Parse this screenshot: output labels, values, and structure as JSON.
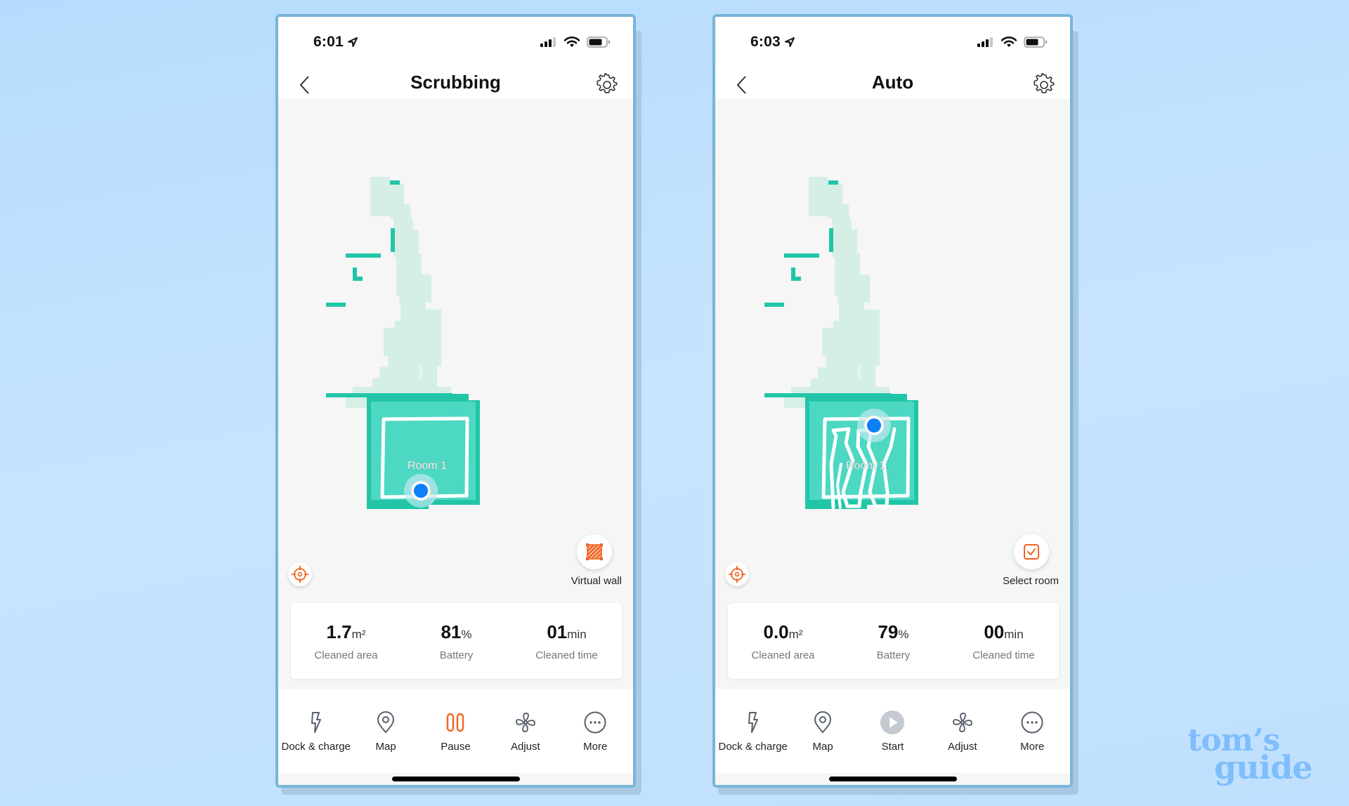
{
  "colors": {
    "accent": "#f26321",
    "map_pale": "#d5efe7",
    "map_wall": "#22c5a8",
    "room_fill": "#4cd8c3",
    "robot_dot": "#0d7ff7",
    "icon_gray": "#58616b",
    "start_disabled": "#c5c9d1"
  },
  "phones": [
    {
      "status": {
        "time": "6:01"
      },
      "nav": {
        "title": "Scrubbing"
      },
      "map": {
        "room_label": "Room 1"
      },
      "float_action": {
        "label": "Virtual wall",
        "icon": "virtual-wall-icon"
      },
      "stats": [
        {
          "value": "1.7",
          "unit": "m²",
          "label": "Cleaned area"
        },
        {
          "value": "81",
          "unit": "%",
          "label": "Battery"
        },
        {
          "value": "01",
          "unit": "min",
          "label": "Cleaned time"
        }
      ],
      "bottom_nav": [
        {
          "label": "Dock & charge",
          "icon": "dock-charge-icon"
        },
        {
          "label": "Map",
          "icon": "map-pin-icon"
        },
        {
          "label": "Pause",
          "icon": "pause-icon"
        },
        {
          "label": "Adjust",
          "icon": "fan-icon"
        },
        {
          "label": "More",
          "icon": "more-icon"
        }
      ]
    },
    {
      "status": {
        "time": "6:03"
      },
      "nav": {
        "title": "Auto"
      },
      "map": {
        "room_label": "Room 1"
      },
      "float_action": {
        "label": "Select room",
        "icon": "select-room-icon"
      },
      "stats": [
        {
          "value": "0.0",
          "unit": "m²",
          "label": "Cleaned area"
        },
        {
          "value": "79",
          "unit": "%",
          "label": "Battery"
        },
        {
          "value": "00",
          "unit": "min",
          "label": "Cleaned time"
        }
      ],
      "bottom_nav": [
        {
          "label": "Dock & charge",
          "icon": "dock-charge-icon"
        },
        {
          "label": "Map",
          "icon": "map-pin-icon"
        },
        {
          "label": "Start",
          "icon": "play-icon"
        },
        {
          "label": "Adjust",
          "icon": "fan-icon"
        },
        {
          "label": "More",
          "icon": "more-icon"
        }
      ]
    }
  ],
  "watermark": {
    "line1": "tom’s",
    "line2": "guide"
  }
}
